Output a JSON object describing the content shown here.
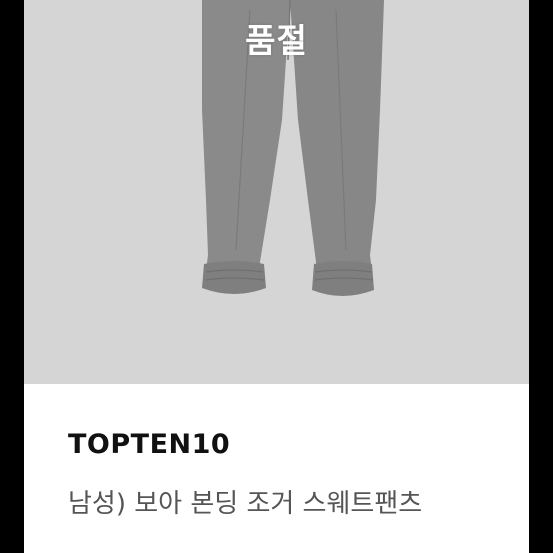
{
  "product": {
    "status_overlay": "품절",
    "brand": "TOPTEN10",
    "name": "남성) 보아 본딩 조거 스웨트팬츠",
    "image_subject": "gray jogger sweatpants"
  },
  "colors": {
    "background": "#000000",
    "card": "#ffffff",
    "photo_background": "#d5d5d5",
    "pants": "#8a8a8a",
    "overlay_text": "#ffffff",
    "brand_text": "#111111",
    "name_text": "#555555"
  }
}
